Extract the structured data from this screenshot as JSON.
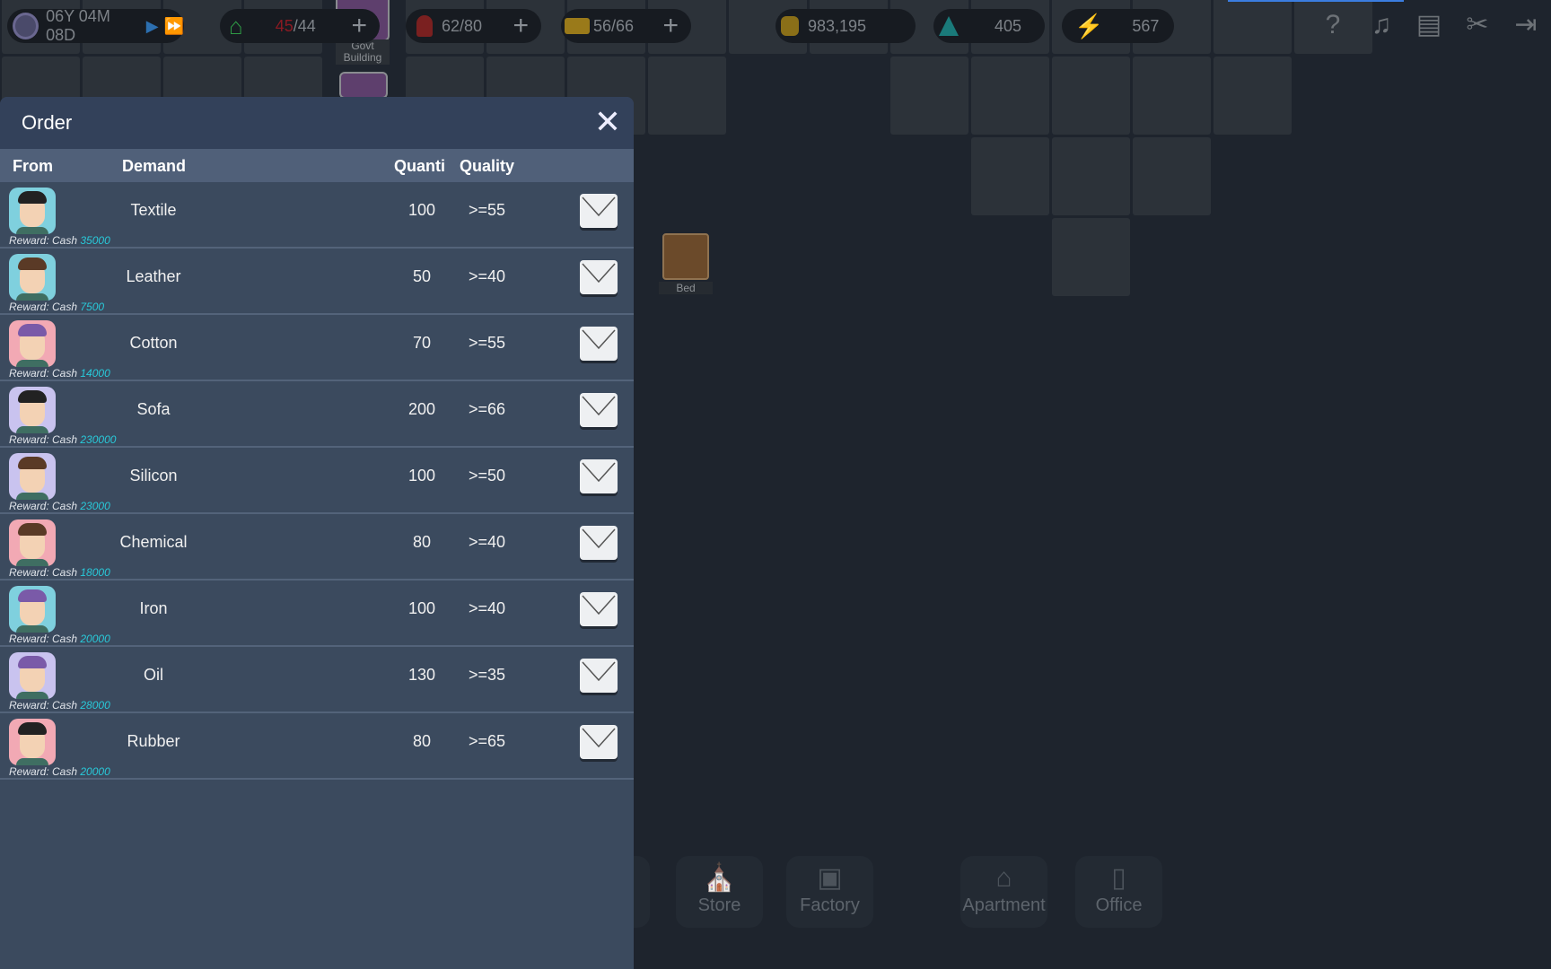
{
  "topbar": {
    "date": "06Y 04M 08D",
    "housing": {
      "current": "45",
      "max": "/44",
      "current_color": "#b0202a"
    },
    "workers": "62/80",
    "trucks": "56/66",
    "cash": "983,195",
    "research": "405",
    "energy": "567",
    "icons": [
      "help-icon",
      "music-icon",
      "shop-icon",
      "scissors-icon",
      "exit-icon"
    ]
  },
  "map": {
    "govt_label": "Govt Building",
    "bed_label": "Bed"
  },
  "order": {
    "title": "Order",
    "columns": {
      "from": "From",
      "demand": "Demand",
      "quantity": "Quanti",
      "quality": "Quality"
    },
    "reward_prefix": "Reward: Cash ",
    "rows": [
      {
        "demand": "Textile",
        "quantity": "100",
        "quality": ">=55",
        "reward": "35000",
        "avatar_bg": "#7fd0de",
        "hair": "#222"
      },
      {
        "demand": "Leather",
        "quantity": "50",
        "quality": ">=40",
        "reward": "7500",
        "avatar_bg": "#7fd0de",
        "hair": "#5a3a26"
      },
      {
        "demand": "Cotton",
        "quantity": "70",
        "quality": ">=55",
        "reward": "14000",
        "avatar_bg": "#f2a9b4",
        "hair": "#7a5aa8"
      },
      {
        "demand": "Sofa",
        "quantity": "200",
        "quality": ">=66",
        "reward": "230000",
        "avatar_bg": "#c9c3ef",
        "hair": "#222"
      },
      {
        "demand": "Silicon",
        "quantity": "100",
        "quality": ">=50",
        "reward": "23000",
        "avatar_bg": "#c9c3ef",
        "hair": "#5a3a26"
      },
      {
        "demand": "Chemical",
        "quantity": "80",
        "quality": ">=40",
        "reward": "18000",
        "avatar_bg": "#f2a9b4",
        "hair": "#5a3a26"
      },
      {
        "demand": "Iron",
        "quantity": "100",
        "quality": ">=40",
        "reward": "20000",
        "avatar_bg": "#7fd0de",
        "hair": "#7a5aa8"
      },
      {
        "demand": "Oil",
        "quantity": "130",
        "quality": ">=35",
        "reward": "28000",
        "avatar_bg": "#c9c3ef",
        "hair": "#7a5aa8"
      },
      {
        "demand": "Rubber",
        "quantity": "80",
        "quality": ">=65",
        "reward": "20000",
        "avatar_bg": "#f2a9b4",
        "hair": "#222"
      }
    ]
  },
  "build_menu": [
    "Store",
    "Factory",
    "Apartment",
    "Office"
  ]
}
